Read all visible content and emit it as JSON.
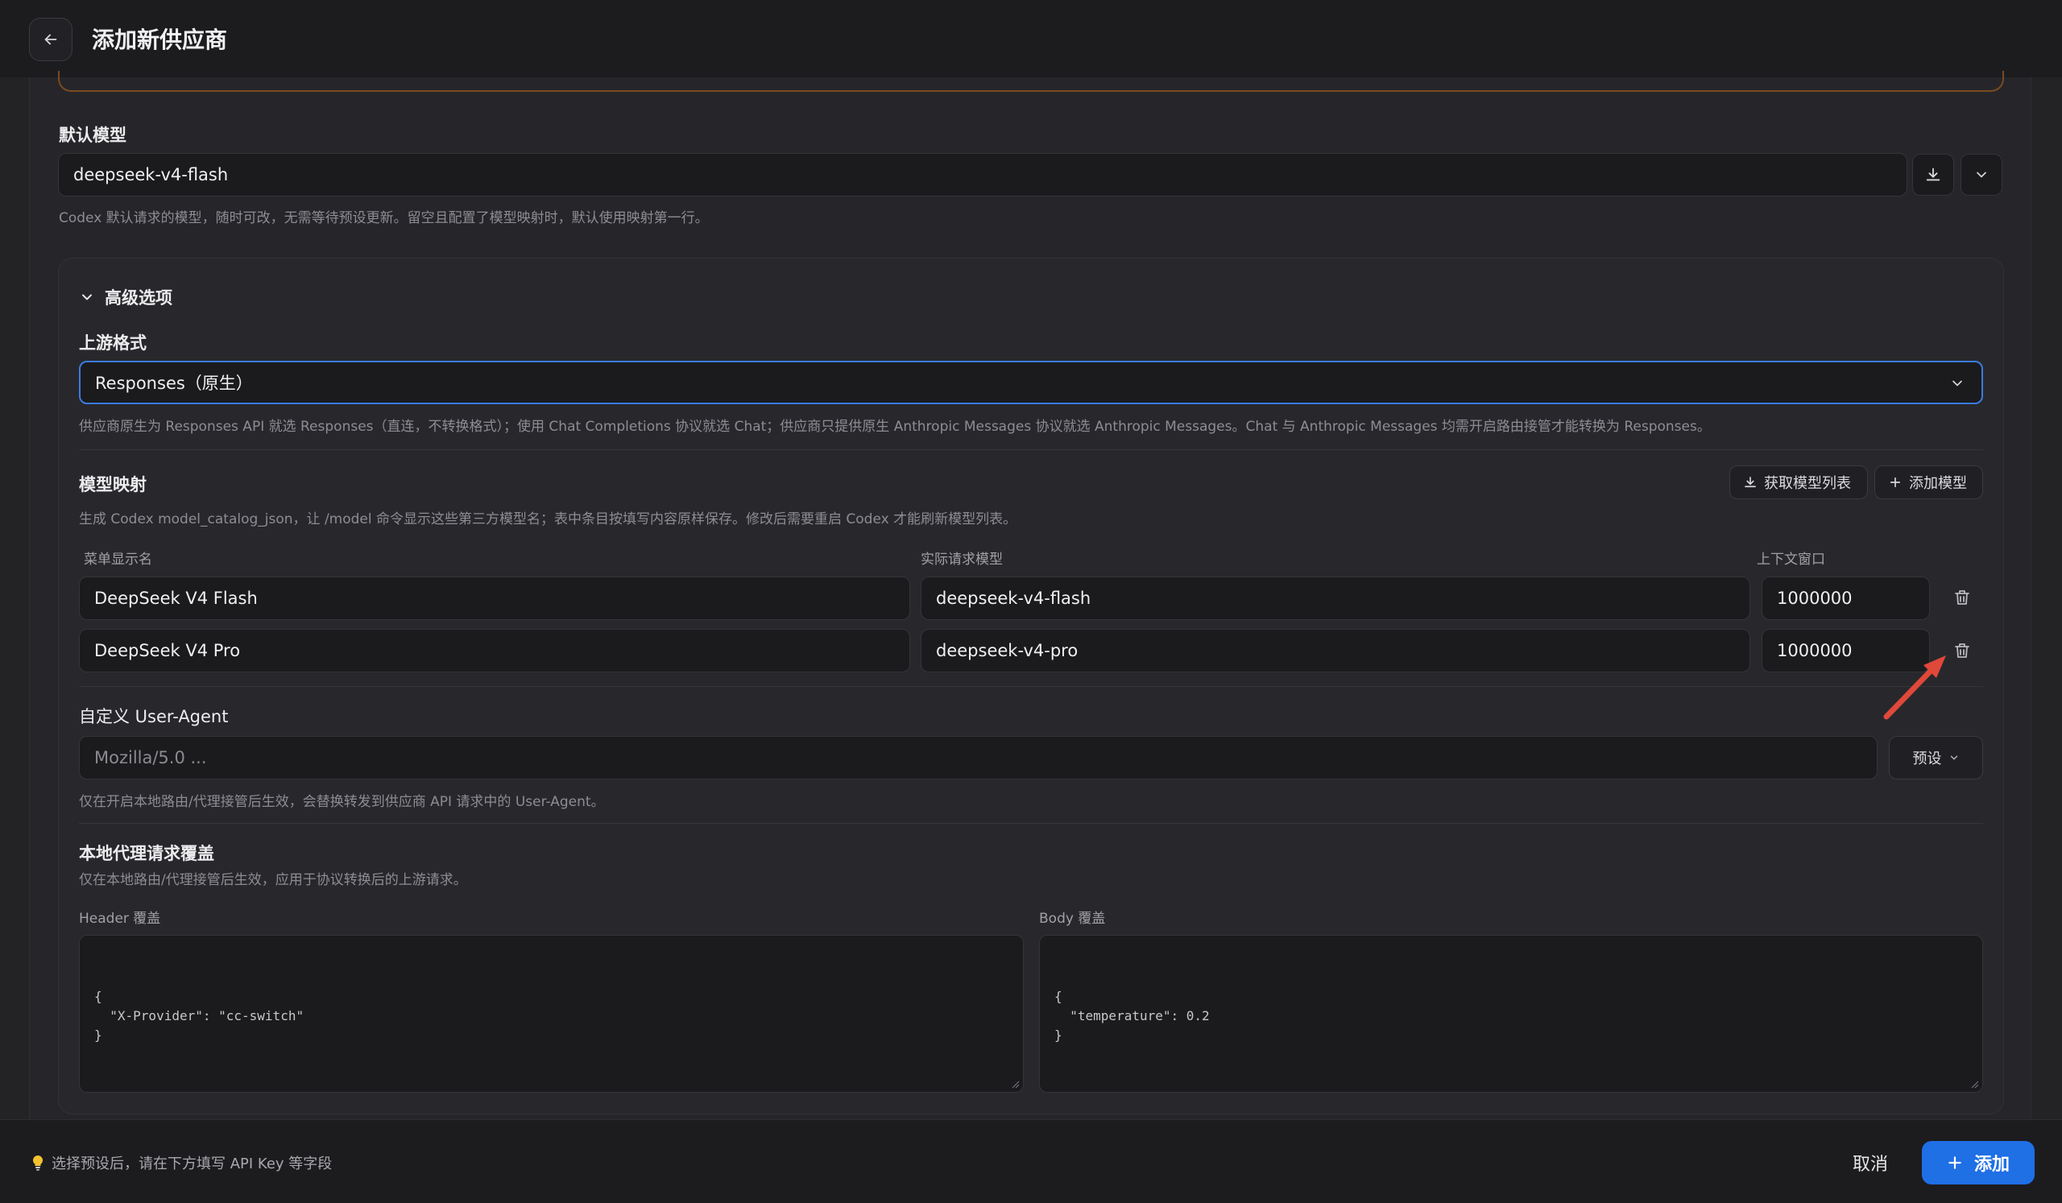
{
  "header": {
    "title": "添加新供应商"
  },
  "default_model": {
    "label": "默认模型",
    "value": "deepseek-v4-flash",
    "hint": "Codex 默认请求的模型，随时可改，无需等待预设更新。留空且配置了模型映射时，默认使用映射第一行。"
  },
  "advanced": {
    "toggle_label": "高级选项",
    "upstream_format": {
      "label": "上游格式",
      "selected": "Responses（原生）",
      "hint": "供应商原生为 Responses API 就选 Responses（直连，不转换格式）；使用 Chat Completions 协议就选 Chat；供应商只提供原生 Anthropic Messages 协议就选 Anthropic Messages。Chat 与 Anthropic Messages 均需开启路由接管才能转换为 Responses。"
    },
    "model_mapping": {
      "label": "模型映射",
      "hint": "生成 Codex model_catalog_json，让 /model 命令显示这些第三方模型名；表中条目按填写内容原样保存。修改后需要重启 Codex 才能刷新模型列表。",
      "fetch_button": "获取模型列表",
      "add_button": "添加模型",
      "columns": [
        "菜单显示名",
        "实际请求模型",
        "上下文窗口"
      ],
      "rows": [
        {
          "display": "DeepSeek V4 Flash",
          "model": "deepseek-v4-flash",
          "context": "1000000"
        },
        {
          "display": "DeepSeek V4 Pro",
          "model": "deepseek-v4-pro",
          "context": "1000000"
        }
      ]
    },
    "user_agent": {
      "label": "自定义 User-Agent",
      "placeholder": "Mozilla/5.0 ...",
      "preset_button": "预设",
      "hint": "仅在开启本地路由/代理接管后生效，会替换转发到供应商 API 请求中的 User-Agent。"
    },
    "override": {
      "label": "本地代理请求覆盖",
      "hint": "仅在本地路由/代理接管后生效，应用于协议转换后的上游请求。",
      "header_label": "Header 覆盖",
      "header_value": "{\n  \"X-Provider\": \"cc-switch\"\n}",
      "body_label": "Body 覆盖",
      "body_value": "{\n  \"temperature\": 0.2\n}"
    }
  },
  "footer": {
    "tip": "选择预设后，请在下方填写 API Key 等字段",
    "cancel": "取消",
    "add": "添加"
  },
  "colors": {
    "accent": "#1f6fe5",
    "focus_border": "#3b7be0",
    "annotation_arrow": "#e0483a"
  }
}
